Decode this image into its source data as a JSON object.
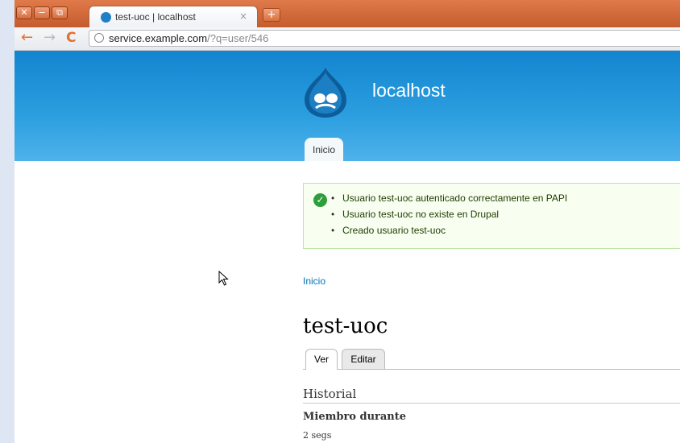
{
  "window": {
    "close_glyph": "✕",
    "minimize_glyph": "−",
    "restore_glyph": "⧉"
  },
  "tab": {
    "title": "test-uoc | localhost",
    "close_glyph": "×",
    "new_tab_glyph": "+"
  },
  "toolbar": {
    "back_glyph": "←",
    "forward_glyph": "→",
    "reload_glyph": "C",
    "url_host": "service.example.com",
    "url_path": "/?q=user/546"
  },
  "header": {
    "site_name": "localhost",
    "menu_items": [
      "Inicio"
    ]
  },
  "messages": {
    "status": "ok",
    "items": [
      "Usuario test-uoc autenticado correctamente en PAPI",
      "Usuario test-uoc no existe en Drupal",
      "Creado usuario test-uoc"
    ]
  },
  "breadcrumb": "Inicio",
  "page": {
    "title": "test-uoc",
    "tabs": [
      {
        "label": "Ver",
        "active": true
      },
      {
        "label": "Editar",
        "active": false
      }
    ],
    "section_heading": "Historial",
    "member_label": "Miembro durante",
    "member_value": "2 segs"
  },
  "colors": {
    "titlebar": "#c45c2e",
    "header_blue": "#1384cf",
    "link": "#0071b3",
    "message_bg": "#f8fff0",
    "ok_green": "#2f9d3a"
  }
}
